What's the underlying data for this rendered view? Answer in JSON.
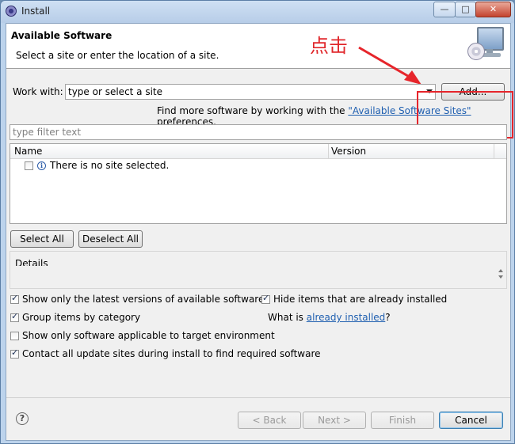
{
  "window": {
    "title": "Install",
    "minimize": "—",
    "maximize": "□",
    "close": "✕"
  },
  "header": {
    "title": "Available Software",
    "description": "Select a site or enter the location of a site."
  },
  "annotation": {
    "text": "点击",
    "color": "#e0262a"
  },
  "work_with": {
    "label": "Work with:",
    "value": "type or select a site",
    "add_button": "Add...",
    "find_more_prefix": "Find more software by working with the ",
    "find_more_link": "\"Available Software Sites\"",
    "find_more_suffix": " preferences."
  },
  "filter": {
    "placeholder": "type filter text"
  },
  "table": {
    "columns": [
      "Name",
      "Version"
    ],
    "rows": [
      {
        "name": "There is no site selected.",
        "checked": false
      }
    ]
  },
  "selection_buttons": {
    "select_all": "Select All",
    "deselect_all": "Deselect All"
  },
  "details": {
    "label": "Details",
    "text": ""
  },
  "options": {
    "show_latest": {
      "label": "Show only the latest versions of available software",
      "checked": true
    },
    "group_by_category": {
      "label": "Group items by category",
      "checked": true
    },
    "applicable_only": {
      "label": "Show only software applicable to target environment",
      "checked": false
    },
    "contact_all_sites": {
      "label": "Contact all update sites during install to find required software",
      "checked": true
    },
    "hide_installed": {
      "label": "Hide items that are already installed",
      "checked": true
    },
    "what_is_prefix": "What is ",
    "what_is_link": "already installed",
    "what_is_suffix": "?"
  },
  "footer": {
    "back": "< Back",
    "next": "Next >",
    "finish": "Finish",
    "cancel": "Cancel"
  },
  "colors": {
    "link": "#1f5fb0",
    "highlight_box": "#e6252b",
    "titlebar": "#bcd3ec"
  }
}
